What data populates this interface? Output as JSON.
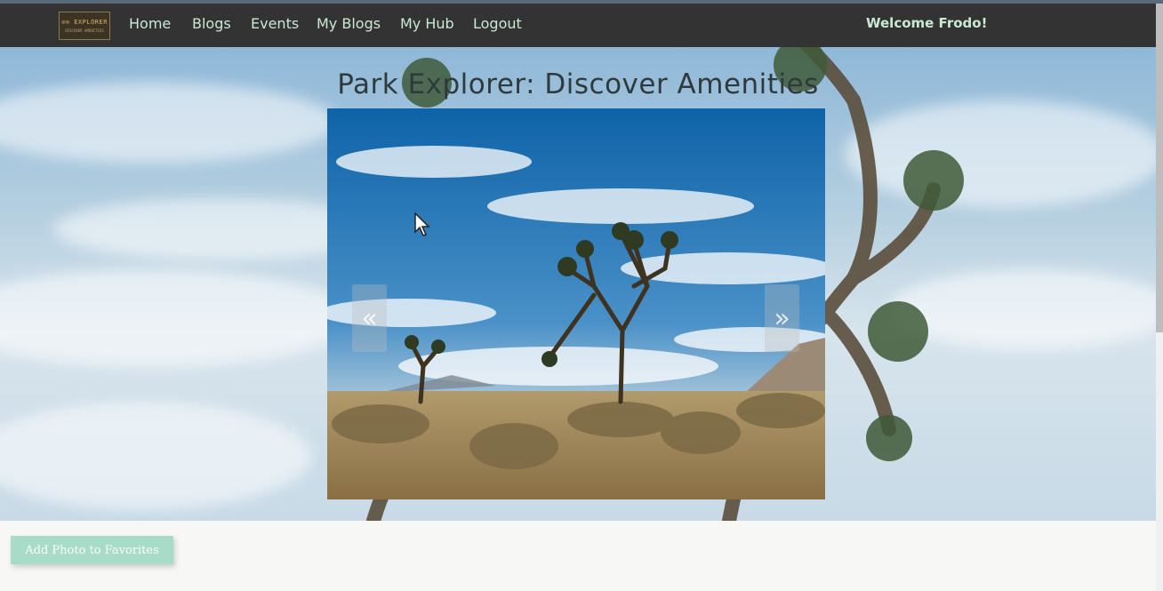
{
  "logo": {
    "line1": "⊙⊙ EXPLORER",
    "line2": "DISCOVER AMENITIES"
  },
  "nav": {
    "home": "Home",
    "blogs": "Blogs",
    "events": "Events",
    "my_blogs": "My Blogs",
    "my_hub": "My Hub",
    "logout": "Logout",
    "welcome": "Welcome Frodo!"
  },
  "main": {
    "title": "Park Explorer: Discover Amenities",
    "carousel": {
      "prev_label": "«",
      "next_label": "»"
    }
  },
  "actions": {
    "add_favorite": "Add Photo to Favorites"
  },
  "colors": {
    "navbar": "#333333",
    "nav_text": "#c9ead2",
    "button": "#a7dcc9"
  }
}
